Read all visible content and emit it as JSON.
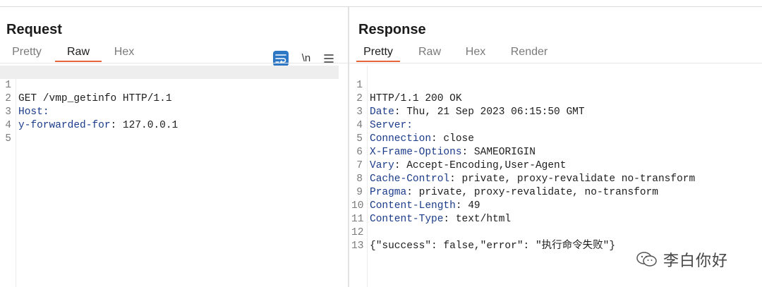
{
  "request": {
    "title": "Request",
    "tabs": [
      {
        "label": "Pretty",
        "active": false
      },
      {
        "label": "Raw",
        "active": true
      },
      {
        "label": "Hex",
        "active": false
      }
    ],
    "toolbar": {
      "wrap_icon": "wrap-lines-icon",
      "newline_label": "\\n",
      "menu_icon": "hamburger-menu-icon"
    },
    "lines": [
      {
        "num": "1",
        "key": "",
        "rest": "GET /vmp_getinfo HTTP/1.1"
      },
      {
        "num": "2",
        "key": "Host",
        "rest": ":"
      },
      {
        "num": "3",
        "key": "y-forwarded-for",
        "rest": ": 127.0.0.1"
      },
      {
        "num": "4",
        "key": "",
        "rest": ""
      },
      {
        "num": "5",
        "key": "",
        "rest": ""
      }
    ]
  },
  "response": {
    "title": "Response",
    "tabs": [
      {
        "label": "Pretty",
        "active": true
      },
      {
        "label": "Raw",
        "active": false
      },
      {
        "label": "Hex",
        "active": false
      },
      {
        "label": "Render",
        "active": false
      }
    ],
    "lines": [
      {
        "num": "1",
        "key": "",
        "rest": "HTTP/1.1 200 OK"
      },
      {
        "num": "2",
        "key": "Date",
        "rest": ": Thu, 21 Sep 2023 06:15:50 GMT"
      },
      {
        "num": "3",
        "key": "Server",
        "rest": ":"
      },
      {
        "num": "4",
        "key": "Connection",
        "rest": ": close"
      },
      {
        "num": "5",
        "key": "X-Frame-Options",
        "rest": ": SAMEORIGIN"
      },
      {
        "num": "6",
        "key": "Vary",
        "rest": ": Accept-Encoding,User-Agent"
      },
      {
        "num": "7",
        "key": "Cache-Control",
        "rest": ": private, proxy-revalidate no-transform"
      },
      {
        "num": "8",
        "key": "Pragma",
        "rest": ": private, proxy-revalidate, no-transform"
      },
      {
        "num": "9",
        "key": "Content-Length",
        "rest": ": 49"
      },
      {
        "num": "10",
        "key": "Content-Type",
        "rest": ": text/html"
      },
      {
        "num": "11",
        "key": "",
        "rest": ""
      },
      {
        "num": "12",
        "key": "",
        "rest": "{\"success\": false,\"error\": \"执行命令失败\"}"
      },
      {
        "num": "13",
        "key": "",
        "rest": ""
      }
    ]
  },
  "watermark": {
    "icon": "wechat-icon",
    "text": "李白你好"
  },
  "colors": {
    "accent_tab": "#e8643a",
    "header_key": "#1b3b8a",
    "wrap_button": "#2e77c4"
  }
}
